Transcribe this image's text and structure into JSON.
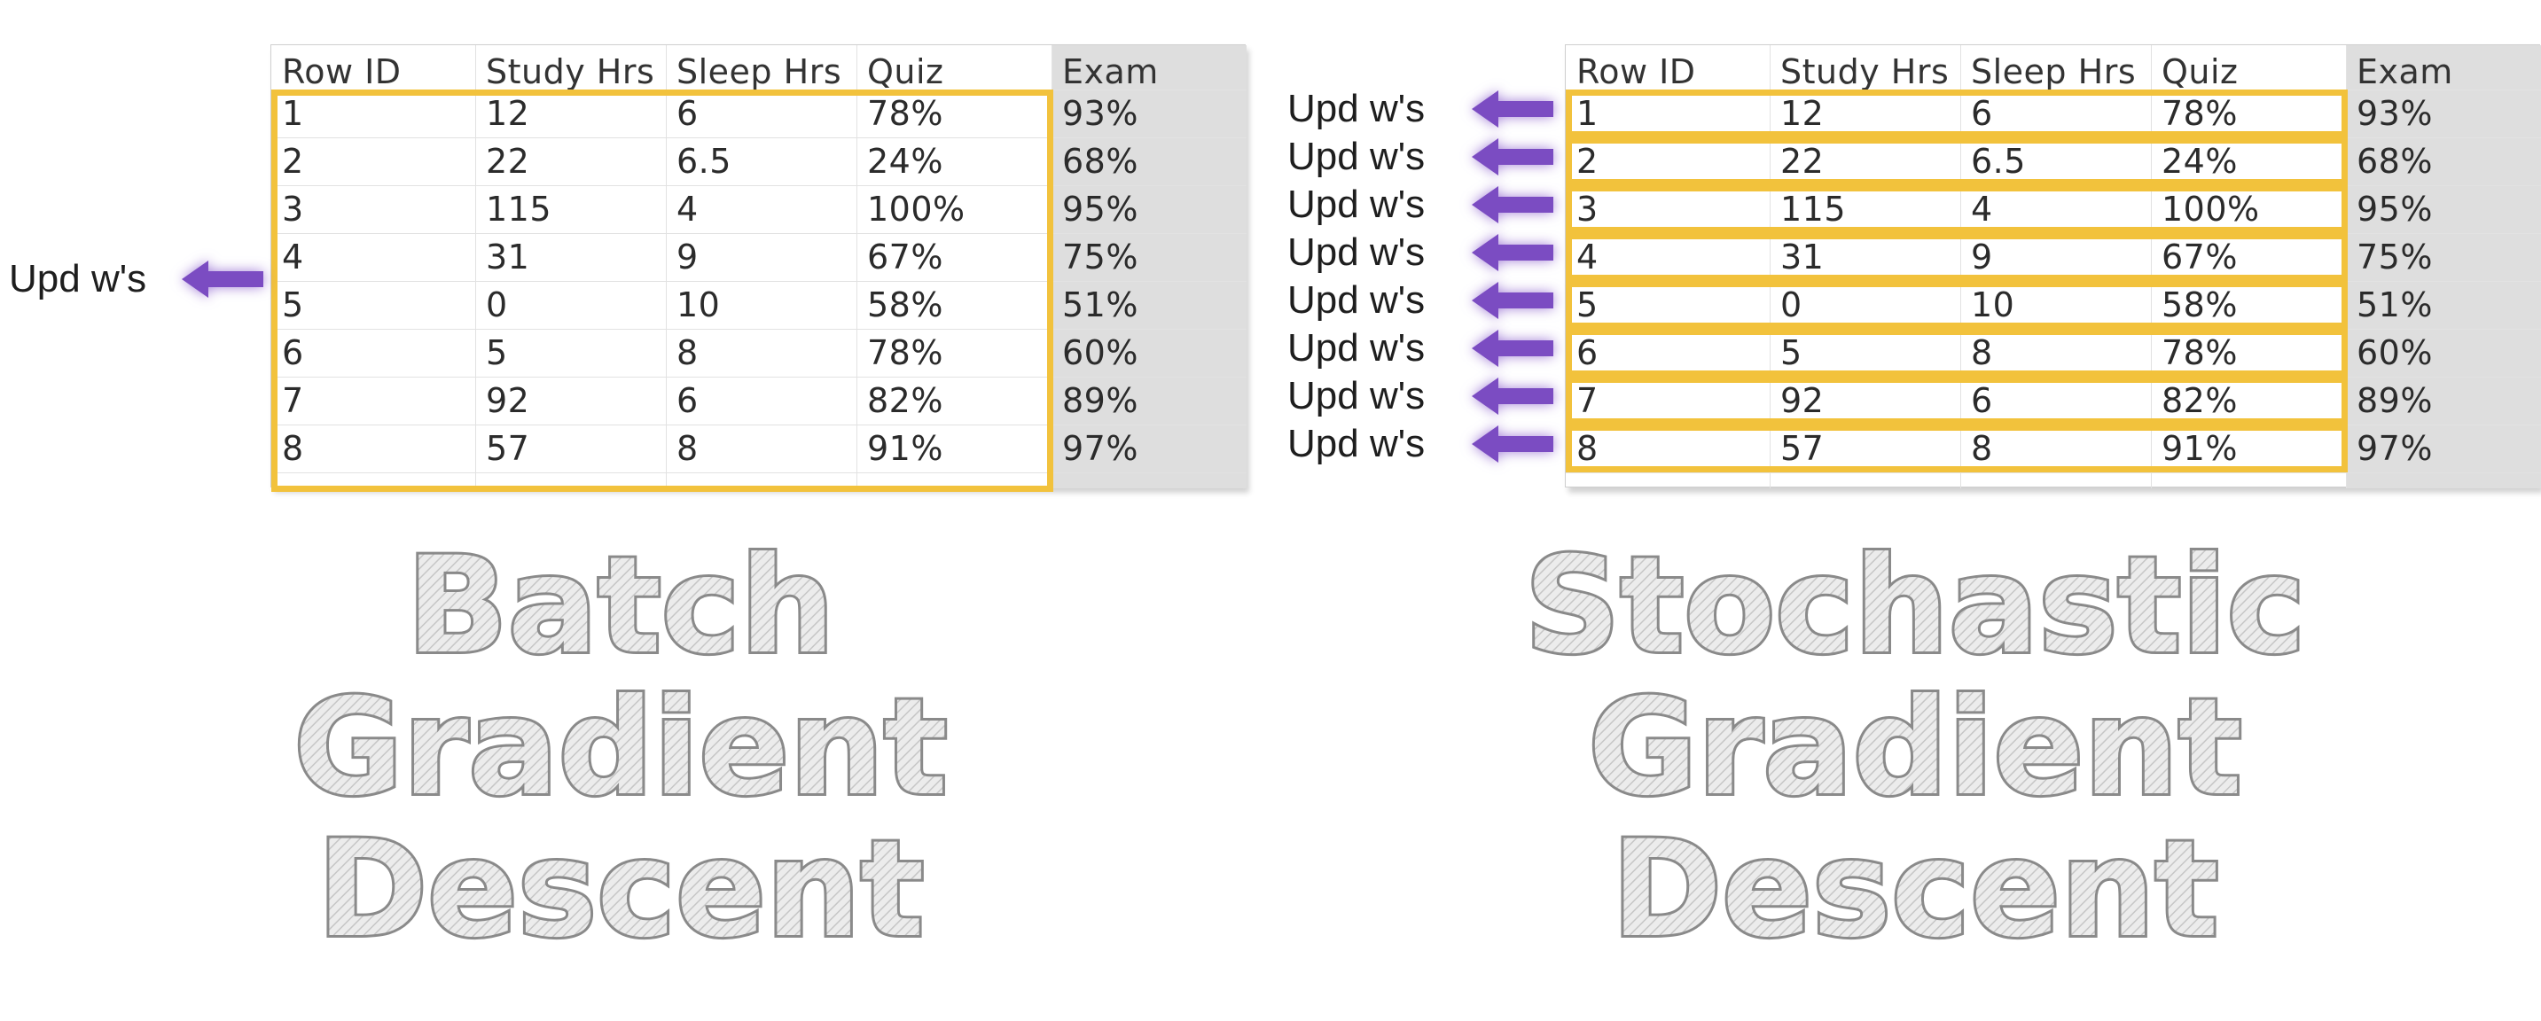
{
  "columns": [
    "Row ID",
    "Study Hrs",
    "Sleep Hrs",
    "Quiz",
    "Exam"
  ],
  "rows": [
    {
      "id": "1",
      "study": "12",
      "sleep": "6",
      "quiz": "78%",
      "exam": "93%"
    },
    {
      "id": "2",
      "study": "22",
      "sleep": "6.5",
      "quiz": "24%",
      "exam": "68%"
    },
    {
      "id": "3",
      "study": "115",
      "sleep": "4",
      "quiz": "100%",
      "exam": "95%"
    },
    {
      "id": "4",
      "study": "31",
      "sleep": "9",
      "quiz": "67%",
      "exam": "75%"
    },
    {
      "id": "5",
      "study": "0",
      "sleep": "10",
      "quiz": "58%",
      "exam": "51%"
    },
    {
      "id": "6",
      "study": "5",
      "sleep": "8",
      "quiz": "78%",
      "exam": "60%"
    },
    {
      "id": "7",
      "study": "92",
      "sleep": "6",
      "quiz": "82%",
      "exam": "89%"
    },
    {
      "id": "8",
      "study": "57",
      "sleep": "8",
      "quiz": "91%",
      "exam": "97%"
    }
  ],
  "left": {
    "title_lines": [
      "Batch",
      "Gradient",
      "Descent"
    ],
    "update_label": "Upd w's"
  },
  "right": {
    "title_lines": [
      "Stochastic",
      "Gradient",
      "Descent"
    ],
    "update_label": "Upd w's"
  },
  "colors": {
    "highlight": "#f2c23c",
    "arrow": "#7b4cc2",
    "title_stroke": "#8a8a8a",
    "title_fill": "#ececec",
    "output_column": "#dedede"
  }
}
